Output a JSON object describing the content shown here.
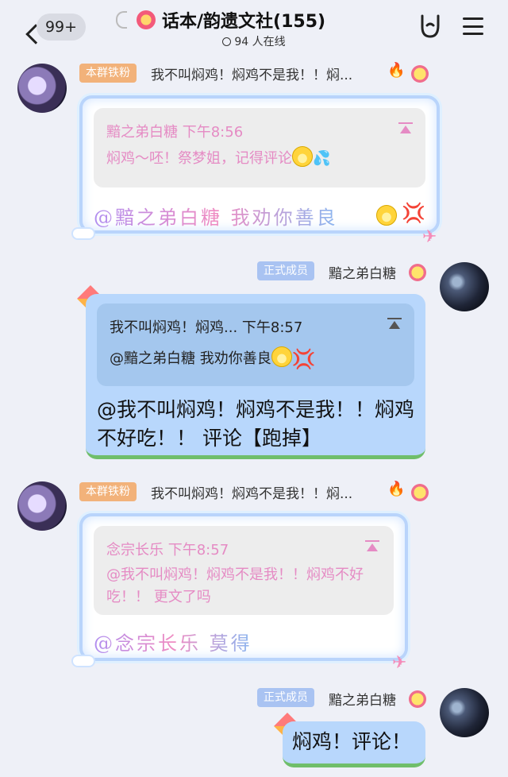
{
  "header": {
    "unread_count": "99+",
    "group_title": "话本/韵遗文社(155)",
    "online_text": "94 人在线"
  },
  "messages": [
    {
      "sender_badge": "本群铁粉",
      "sender_name": "我不叫焖鸡！焖鸡不是我！！焖...",
      "quote_author": "黯之弟白糖",
      "quote_time": "下午8:56",
      "quote_body": "焖鸡～呸！祭梦姐，记得评论",
      "text": "@黯之弟白糖  我劝你善良"
    },
    {
      "sender_badge": "正式成员",
      "sender_name": "黯之弟白糖",
      "quote_author": "我不叫焖鸡！焖鸡...",
      "quote_time": "下午8:57",
      "quote_body": "@黯之弟白糖 我劝你善良",
      "text": "@我不叫焖鸡！焖鸡不是我！！焖鸡不好吃！！ 评论【跑掉】"
    },
    {
      "sender_badge": "本群铁粉",
      "sender_name": "我不叫焖鸡！焖鸡不是我！！焖...",
      "quote_author": "念宗长乐",
      "quote_time": "下午8:57",
      "quote_body": "@我不叫焖鸡！焖鸡不是我！！焖鸡不好吃！！ 更文了吗",
      "text": "@念宗长乐  莫得"
    },
    {
      "sender_badge": "正式成员",
      "sender_name": "黯之弟白糖",
      "text": "焖鸡！评论！"
    }
  ],
  "glyphs": {
    "anger": "💢",
    "sweat": "💦",
    "fire": "🔥",
    "plane": "✈"
  }
}
